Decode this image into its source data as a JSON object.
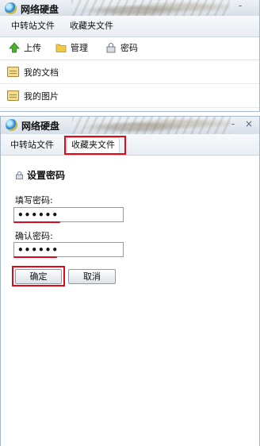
{
  "app": {
    "title": "网络硬盘"
  },
  "tabs": [
    {
      "label": "中转站文件"
    },
    {
      "label": "收藏夹文件"
    }
  ],
  "toolbar": {
    "upload": "上传",
    "manage": "管理",
    "password": "密码"
  },
  "folders": [
    {
      "label": "我的文档"
    },
    {
      "label": "我的图片"
    }
  ],
  "form": {
    "title": "设置密码",
    "fill_label": "填写密码:",
    "fill_value": "••••••",
    "confirm_label": "确认密码:",
    "confirm_value": "••••••",
    "ok": "确定",
    "cancel": "取消"
  },
  "window_controls": {
    "minimize": "-",
    "close": "×"
  },
  "colors": {
    "highlight": "#e0091b",
    "accent": "#2b8fd6"
  }
}
